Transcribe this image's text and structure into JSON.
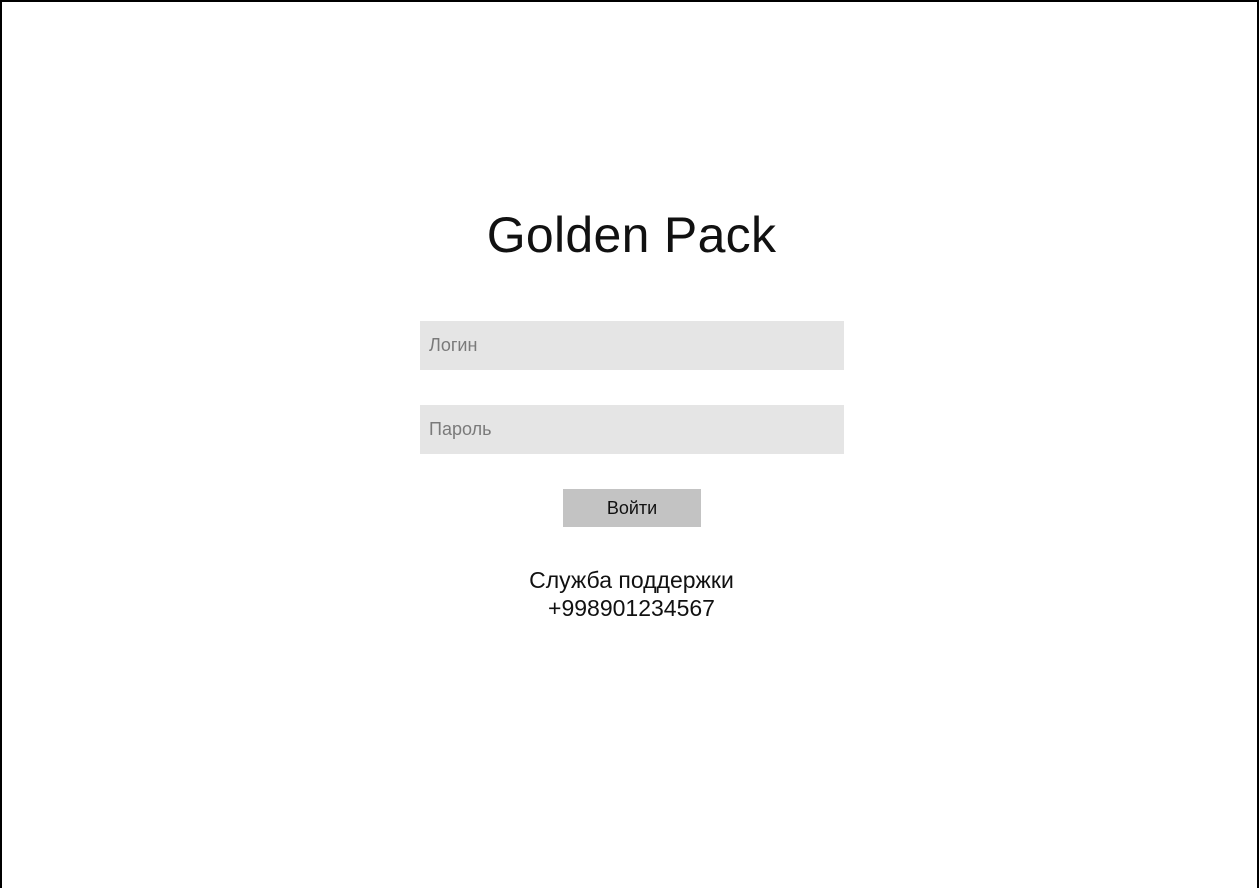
{
  "app": {
    "title": "Golden Pack"
  },
  "login_form": {
    "login_placeholder": "Логин",
    "login_value": "",
    "password_placeholder": "Пароль",
    "password_value": "",
    "submit_label": "Войти"
  },
  "support": {
    "label": "Служба поддержки",
    "phone": "+998901234567"
  },
  "colors": {
    "background": "#ffffff",
    "field_background": "#e5e5e5",
    "button_background": "#c3c3c3",
    "text": "#111111",
    "placeholder": "#7a7a7a"
  }
}
